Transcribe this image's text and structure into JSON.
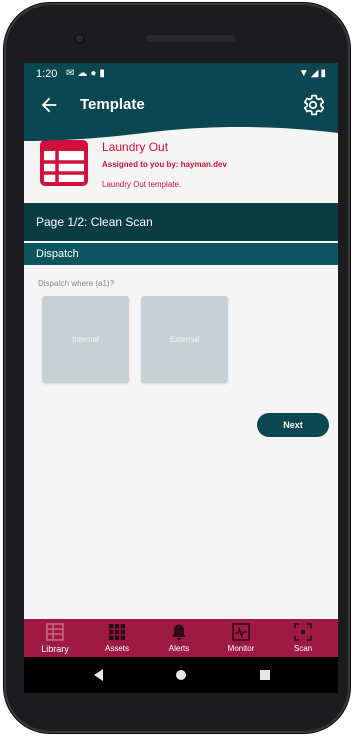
{
  "status_bar": {
    "time": "1:20"
  },
  "app_bar": {
    "title": "Template"
  },
  "template": {
    "name": "Laundry Out",
    "assigned": "Assigned to you by: hayman.dev",
    "description": "Laundry Out template."
  },
  "page": {
    "header": "Page 1/2: Clean Scan",
    "section": "Dispatch",
    "question": "Dispatch where (a1)?",
    "options": [
      "Internal",
      "External"
    ],
    "next_label": "Next"
  },
  "bottom_nav": {
    "items": [
      {
        "label": "Library",
        "icon": "library-icon"
      },
      {
        "label": "Assets",
        "icon": "assets-grid-icon"
      },
      {
        "label": "Alerts",
        "icon": "bell-icon"
      },
      {
        "label": "Monitor",
        "icon": "monitor-icon"
      },
      {
        "label": "Scan",
        "icon": "scan-icon"
      }
    ]
  },
  "colors": {
    "primary_dark": "#0a4750",
    "accent": "#d0103a",
    "nav_bg": "#9e1a45",
    "option_tile": "#c5d1d3"
  }
}
